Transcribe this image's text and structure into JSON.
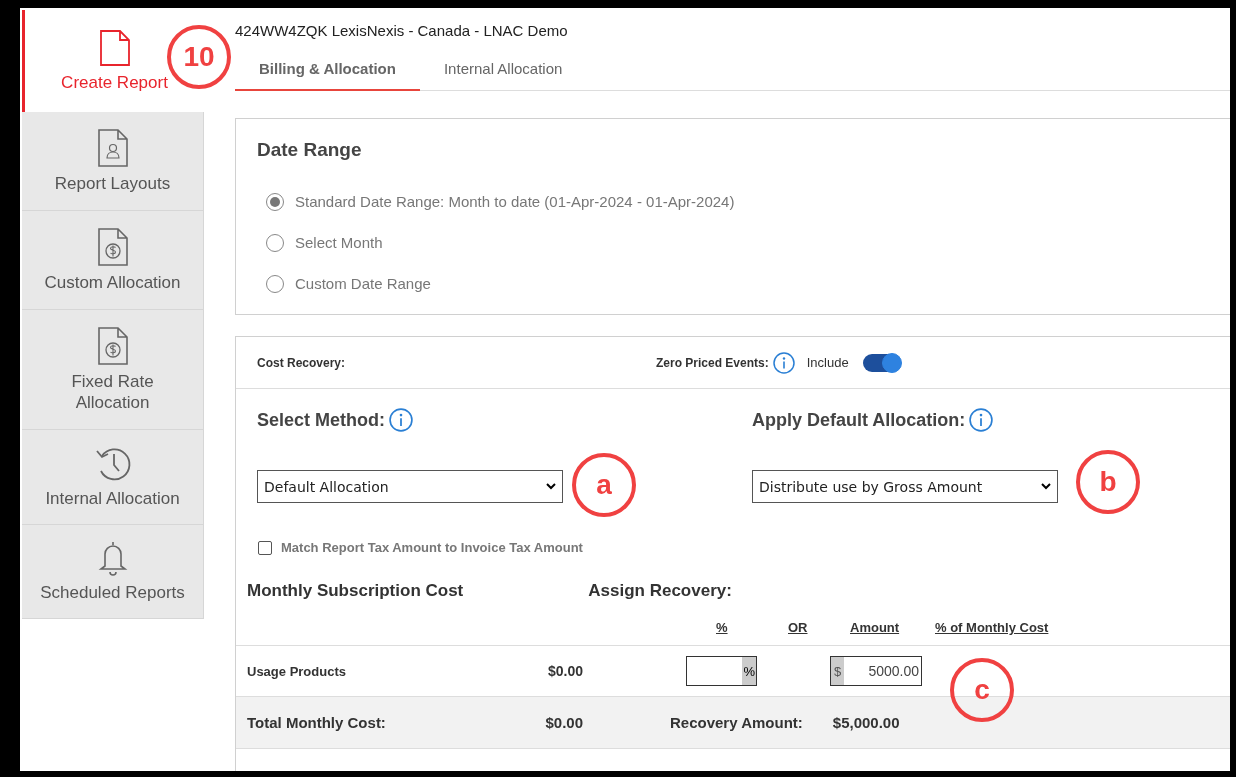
{
  "header": {
    "title": "424WW4ZQK LexisNexis - Canada - LNAC Demo"
  },
  "sidebar": {
    "items": [
      {
        "label": "Create Report",
        "kind": "document",
        "selected": true
      },
      {
        "label": "Report Layouts",
        "kind": "profile",
        "selected": false
      },
      {
        "label": "Custom Allocation",
        "kind": "dollar",
        "selected": false
      },
      {
        "label": "Fixed Rate Allocation",
        "kind": "dollar",
        "selected": false
      },
      {
        "label": "Internal Allocation",
        "kind": "history",
        "selected": false
      },
      {
        "label": "Scheduled Reports",
        "kind": "bell",
        "selected": false
      }
    ]
  },
  "tabs": [
    {
      "label": "Billing & Allocation",
      "selected": true
    },
    {
      "label": "Internal Allocation",
      "selected": false
    }
  ],
  "date_range": {
    "title": "Date Range",
    "options": [
      {
        "label": "Standard Date Range: Month to date (01-Apr-2024 - 01-Apr-2024)",
        "selected": true
      },
      {
        "label": "Select Month",
        "selected": false
      },
      {
        "label": "Custom Date Range",
        "selected": false
      }
    ]
  },
  "cost_recovery": {
    "label": "Cost Recovery:",
    "zero_priced_label": "Zero Priced Events:",
    "include_label": "Include",
    "include_on": true
  },
  "select_method": {
    "label": "Select Method:",
    "value": "Default Allocation"
  },
  "default_allocation": {
    "label": "Apply Default Allocation:",
    "value": "Distribute use by Gross Amount"
  },
  "match_tax": {
    "label": "Match Report Tax Amount to Invoice Tax Amount",
    "checked": false
  },
  "subscription": {
    "title": "Monthly Subscription Cost",
    "assign_title": "Assign Recovery:",
    "columns": [
      "%",
      "OR",
      "Amount",
      "% of Monthly Cost"
    ],
    "rows": [
      {
        "name": "Usage Products",
        "cost": "$0.00",
        "percent_suffix": "%",
        "amount_prefix": "$",
        "amount": "5000.00"
      }
    ],
    "total": {
      "label": "Total Monthly Cost:",
      "cost": "$0.00",
      "recovery_label": "Recovery Amount:",
      "recovery": "$5,000.00"
    }
  },
  "callouts": [
    {
      "label": "10"
    },
    {
      "label": "a"
    },
    {
      "label": "b"
    },
    {
      "label": "c"
    }
  ]
}
